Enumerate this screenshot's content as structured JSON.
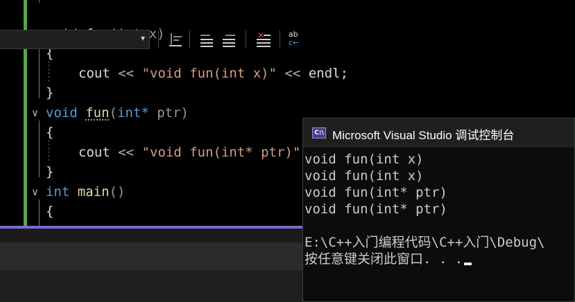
{
  "editor": {
    "lines": [
      {
        "keyword": "void",
        "name": "fun",
        "open": "(",
        "param_type": "int",
        "param_name": " x",
        "close": ")"
      },
      {
        "brace": "{"
      },
      {
        "cout": "cout",
        "op1": "<<",
        "string": "\"void fun(int x)\"",
        "op2": "<<",
        "endl": "endl;"
      },
      {
        "brace": "}"
      },
      {
        "keyword": "void",
        "name": "fun",
        "open": "(",
        "param_type": "int*",
        "param_name": " ptr",
        "close": ")"
      },
      {
        "brace": "{"
      },
      {
        "cout": "cout",
        "op1": "<<",
        "string": "\"void fun(int* ptr)\""
      },
      {
        "brace": "}"
      },
      {
        "keyword": "int",
        "name": "main",
        "parens": "()"
      },
      {
        "brace": "{"
      }
    ]
  },
  "console": {
    "title": "Microsoft Visual Studio 调试控制台",
    "icon_label": "C:\\",
    "output": [
      "void fun(int x)",
      "void fun(int x)",
      "void fun(int* ptr)",
      "void fun(int* ptr)",
      "",
      "E:\\C++入门编程代码\\C++入门\\Debug\\",
      "按任意键关闭此窗口. . ."
    ]
  },
  "toolbar": {
    "dropdown_arrow": "▾",
    "icons": [
      "outdent-icon",
      "decrease-indent-icon",
      "increase-indent-icon",
      "clear-all-icon",
      "word-wrap-icon"
    ]
  },
  "colors": {
    "keyword": "#569cd6",
    "function": "#dcdcaa",
    "string": "#d69d85",
    "change_bar": "#57a64a",
    "panel_accent": "#7a6bd0"
  }
}
